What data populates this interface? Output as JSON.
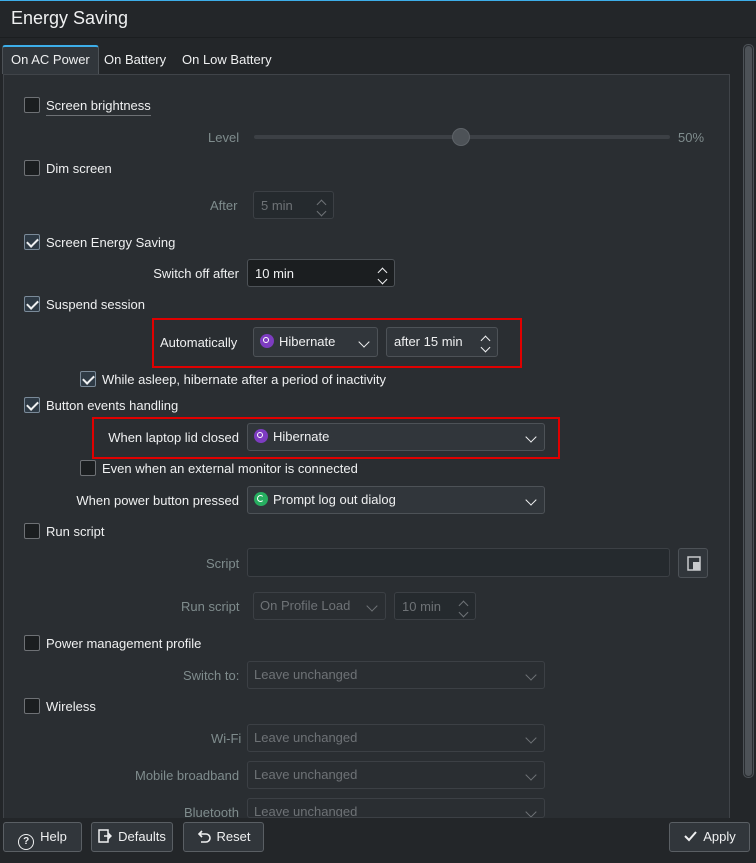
{
  "window": {
    "title": "Energy Saving"
  },
  "tabs": [
    {
      "label": "On AC Power"
    },
    {
      "label": "On Battery"
    },
    {
      "label": "On Low Battery"
    }
  ],
  "brightness": {
    "label": "Screen brightness",
    "checked": false,
    "level_label": "Level",
    "level_value": "50%",
    "level_fraction": 0.5
  },
  "dim": {
    "label": "Dim screen",
    "checked": false,
    "after_label": "After",
    "after_value": "5 min"
  },
  "screen_saving": {
    "label": "Screen Energy Saving",
    "checked": true,
    "switch_label": "Switch off after",
    "switch_value": "10 min"
  },
  "suspend": {
    "label": "Suspend session",
    "checked": true,
    "auto_label": "Automatically",
    "auto_action": "Hibernate",
    "auto_after": "after 15 min",
    "sleep_label": "While asleep, hibernate after a period of inactivity",
    "sleep_checked": true
  },
  "buttons_handling": {
    "label": "Button events handling",
    "checked": true,
    "lid_label": "When laptop lid closed",
    "lid_action": "Hibernate",
    "external_label": "Even when an external monitor is connected",
    "external_checked": false,
    "power_label": "When power button pressed",
    "power_action": "Prompt log out dialog"
  },
  "run_script": {
    "label": "Run script",
    "checked": false,
    "script_label": "Script",
    "script_value": "",
    "run_label": "Run script",
    "run_when": "On Profile Load",
    "run_after": "10 min"
  },
  "profile": {
    "label": "Power management profile",
    "checked": false,
    "switch_label": "Switch to:",
    "switch_value": "Leave unchanged"
  },
  "wireless": {
    "label": "Wireless",
    "checked": false,
    "wifi_label": "Wi-Fi",
    "wifi_value": "Leave unchanged",
    "mobile_label": "Mobile broadband",
    "mobile_value": "Leave unchanged",
    "bt_label": "Bluetooth",
    "bt_value": "Leave unchanged"
  },
  "footer": {
    "help": "Help",
    "defaults": "Defaults",
    "reset": "Reset",
    "apply": "Apply"
  },
  "colors": {
    "highlight": "#e00000",
    "accent": "#3daee9",
    "hibernate_icon": "#7d3cc1",
    "logout_icon": "#27ae60"
  }
}
